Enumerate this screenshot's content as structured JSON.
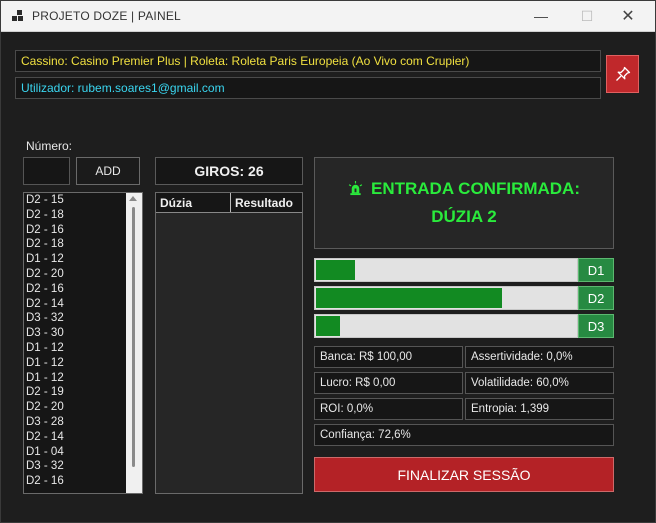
{
  "window": {
    "title": "PROJETO DOZE | PAINEL",
    "minimize": "—",
    "maximize": "☐",
    "close": "✕"
  },
  "info": {
    "casino": "Cassino: Casino Premier Plus | Roleta: Roleta Paris Europeia (Ao Vivo com Crupier)",
    "user": "Utilizador: rubem.soares1@gmail.com"
  },
  "input": {
    "label": "Número:",
    "value": "",
    "add_label": "ADD"
  },
  "history": [
    "D2 - 15",
    "D2 - 18",
    "D2 - 16",
    "D2 - 18",
    "D1 - 12",
    "D2 - 20",
    "D2 - 16",
    "D2 - 14",
    "D3 - 32",
    "D3 - 30",
    "D1 - 12",
    "D1 - 12",
    "D1 - 12",
    "D2 - 19",
    "D2 - 20",
    "D3 - 28",
    "D2 - 14",
    "D1 - 04",
    "D3 - 32",
    "D2 - 16"
  ],
  "giros": "GIROS: 26",
  "table": {
    "col_duzia": "Dúzia",
    "col_resultado": "Resultado"
  },
  "signal": {
    "line1": "ENTRADA CONFIRMADA:",
    "line2": "DÚZIA 2",
    "color": "#2aeb3c",
    "icon": "alarm-light-icon"
  },
  "dozens": [
    {
      "label": "D1",
      "progress": 0.15
    },
    {
      "label": "D2",
      "progress": 0.71
    },
    {
      "label": "D3",
      "progress": 0.09
    }
  ],
  "stats": {
    "banca": "Banca: R$ 100,00",
    "assertividade": "Assertividade: 0,0%",
    "lucro": "Lucro: R$ 0,00",
    "volatilidade": "Volatilidade: 60,0%",
    "roi": "ROI: 0,0%",
    "entropia": "Entropia: 1,399",
    "confianca": "Confiança: 72,6%"
  },
  "finish_label": "FINALIZAR SESSÃO",
  "colors": {
    "accent_red": "#b42226",
    "bar_green": "#128a22",
    "casino_text": "#f0e040",
    "user_text": "#3ad6f0"
  }
}
